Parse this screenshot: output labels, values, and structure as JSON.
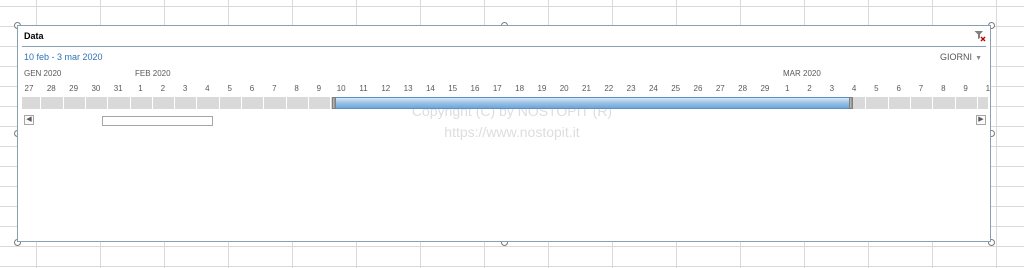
{
  "timeline": {
    "title": "Data",
    "selected_range": "10 feb - 3 mar 2020",
    "granularity": "GIORNI",
    "months": [
      "GEN 2020",
      "FEB 2020",
      "MAR 2020"
    ],
    "days": [
      "27",
      "28",
      "29",
      "30",
      "31",
      "1",
      "2",
      "3",
      "4",
      "5",
      "6",
      "7",
      "8",
      "9",
      "10",
      "11",
      "12",
      "13",
      "14",
      "15",
      "16",
      "17",
      "18",
      "19",
      "20",
      "21",
      "22",
      "23",
      "24",
      "25",
      "26",
      "27",
      "28",
      "29",
      "1",
      "2",
      "3",
      "4",
      "5",
      "6",
      "7",
      "8",
      "9",
      "1"
    ],
    "selection_start_day": "10",
    "selection_end_day": "4"
  },
  "watermark": {
    "line1": "Copyright (C) by NOSTOPIT (R)",
    "line2": "https://www.nostopit.it"
  },
  "icons": {
    "clear_filter": "filter-clear-icon",
    "scroll_left": "triangle-left-icon",
    "scroll_right": "triangle-right-icon"
  },
  "colors": {
    "accent": "#2e75b6",
    "selection": "#9dc3e6",
    "filter_x": "#c00000"
  }
}
